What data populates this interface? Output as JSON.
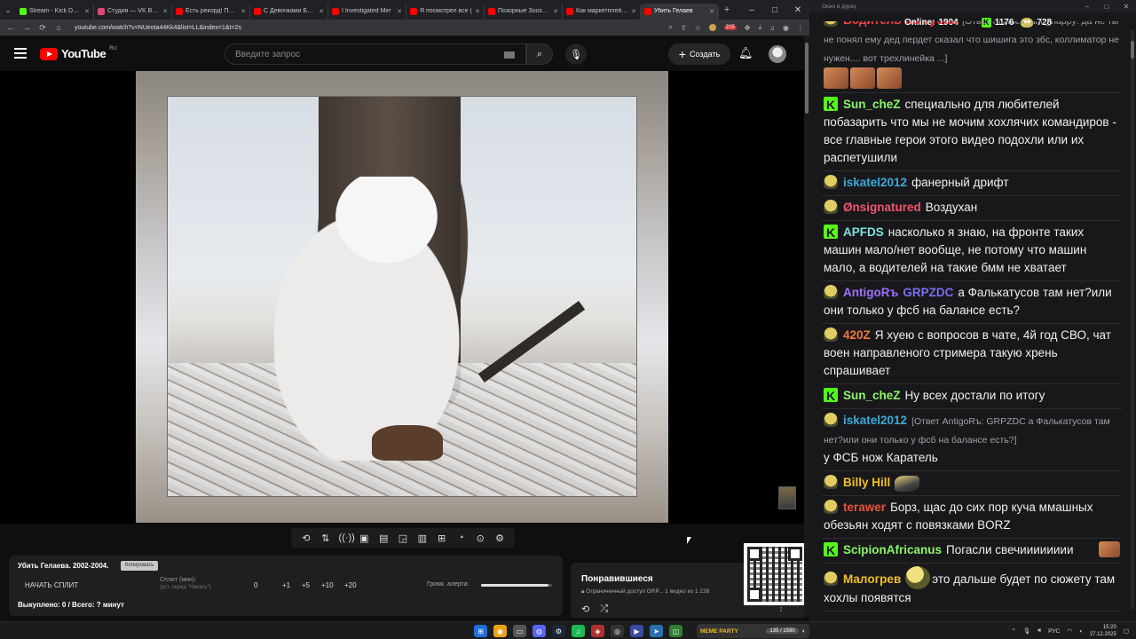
{
  "browser": {
    "tabs": [
      {
        "title": "Stream - Kick Dashb",
        "icon_color": "#53fc18",
        "active": false
      },
      {
        "title": "Студия — VK Видео",
        "icon_color": "#e0477a",
        "active": false
      },
      {
        "title": "Есть рекорд! Перел",
        "icon_color": "#ff0000",
        "active": false
      },
      {
        "title": "С Девочками Болт",
        "icon_color": "#ff0000",
        "active": false
      },
      {
        "title": "I Investigated Mirr",
        "icon_color": "#ff0000",
        "active": false
      },
      {
        "title": "Я посмотрел все (",
        "icon_color": "#ff0000",
        "active": false
      },
      {
        "title": "Позорные Зоозащ",
        "icon_color": "#ff0000",
        "active": false
      },
      {
        "title": "Как маркетплейсы",
        "icon_color": "#ff0000",
        "active": false
      },
      {
        "title": "Убить Гелаев",
        "icon_color": "#ff0000",
        "active": true
      }
    ],
    "url": "youtube.com/watch?v=NUeota44Kk4&list=LL&index=1&t=2s",
    "ext_badge": "215"
  },
  "youtube": {
    "logo_text": "YouTube",
    "region": "RU",
    "search_placeholder": "Введите запрос",
    "create_label": "Создать"
  },
  "stream_panel": {
    "title": "Убить Гелаева. 2002-2004.",
    "copy_label": "Копировать",
    "start_split": "НАЧАТЬ СПЛИТ",
    "split_label": "Сплит (мин):",
    "split_hint": "(уст. перед \"Начать\")",
    "split_value": "0",
    "increments": [
      "+1",
      "+5",
      "+10",
      "+20"
    ],
    "alert_volume_label": "Громк. алерта:",
    "alert_volume": 0.95,
    "done_text": "Выкуплено: 0 / Всего: ? минут"
  },
  "liked_panel": {
    "title": "Понравившиеся",
    "subtitle": "Ограниченный доступ GRP...   1 видео из 1 226"
  },
  "chat": {
    "window_title": "Окно в дурку",
    "online_label": "Online:",
    "online_value": "1904",
    "kick_value": "1176",
    "emote_value": "728",
    "messages": [
      {
        "badge": "bot",
        "user": "Водитель-на-Губаи",
        "color": "#f04040",
        "reply": "[Ответ malines_and_happy: да не ты не понял ему дед пердет сказал что шишига это збс, коллиматор не нужен.... вот трехлинейка ...]",
        "text": "",
        "emotes": 3
      },
      {
        "badge": "kick",
        "user": "Sun_cheZ",
        "color": "#8cf56a",
        "reply": "",
        "text": "специально для любителей побазарить что мы не мочим хохлячих командиров - все главные герои этого видео подохли или их распетушили"
      },
      {
        "badge": "bot",
        "user": "iskatel2012",
        "color": "#3fa9d8",
        "reply": "",
        "text": "фанерный дрифт"
      },
      {
        "badge": "bot",
        "user": "Ønsignatured",
        "color": "#f0566e",
        "reply": "",
        "text": "Воздухан"
      },
      {
        "badge": "kick",
        "user": "APFDS",
        "color": "#7de0e0",
        "reply": "",
        "text": "насколько я знаю, на фронте таких машин мало/нет вообще, не потому что машин мало, а водителей на такие бмм не хватает"
      },
      {
        "badge": "bot",
        "user": "AntigoRъ",
        "user2": "GRPZDC",
        "color": "#a070ff",
        "color2": "#7c6cf0",
        "reply": "",
        "text": "а Фалькатусов там нет?или они только у фсб на балансе есть?"
      },
      {
        "badge": "bot",
        "user": "420Z",
        "color": "#f07a3a",
        "reply": "",
        "text": "Я хуею с вопросов в чате, 4й год СВО, чат воен направленого стримера такую хрень спрашивает"
      },
      {
        "badge": "kick",
        "user": "Sun_cheZ",
        "color": "#8cf56a",
        "reply": "",
        "text": "Ну всех достали по итогу"
      },
      {
        "badge": "bot",
        "user": "iskatel2012",
        "color": "#3fa9d8",
        "reply": "[Ответ AntigoRъ: GRPZDC а Фалькатусов там нет?или они только у фсб на балансе есть?]",
        "text": "у ФСБ нож Каратель"
      },
      {
        "badge": "bot",
        "user": "Billy Hill",
        "color": "#f0c020",
        "reply": "",
        "text": "",
        "emote_cap": true
      },
      {
        "badge": "bot",
        "user": "terawer",
        "color": "#e8543a",
        "reply": "",
        "text": "Борз, щас до сих пор куча ммашных обезьян ходят с повязками BORZ"
      },
      {
        "badge": "kick",
        "user": "ScipionAfricanus",
        "color": "#8cf56a",
        "reply": "",
        "text": "Погасли свечииииииии",
        "emote_end": true
      },
      {
        "badge": "bot",
        "user": "Малогрев",
        "color": "#f0c020",
        "reply": "",
        "text": "это дальше будет по сюжету там хохлы появятся",
        "emote_pepe": true
      }
    ]
  },
  "taskbar": {
    "widget_label": "MEME PARTY",
    "widget_count": "135 / 1590",
    "lang": "РУС",
    "time": "15:20",
    "date": "27.12.2025"
  }
}
